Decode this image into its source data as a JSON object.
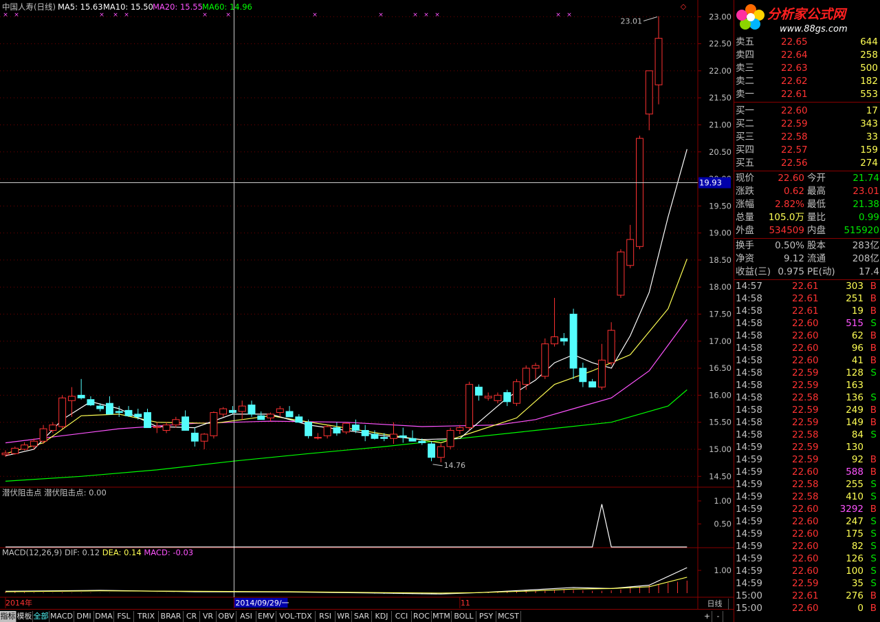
{
  "header": {
    "stock": "中国人寿(日线)",
    "ma5": "MA5: 15.63",
    "ma10": "MA10: 15.50",
    "ma20": "MA20: 15.55",
    "ma60": "MA60: 14.96"
  },
  "colors": {
    "up": "#ff3232",
    "down": "#54fcfc",
    "ma5": "#ffffff",
    "ma10": "#ffff54",
    "ma20": "#ff54ff",
    "ma60": "#00ff00",
    "axis": "#8a0000",
    "text": "#c0c0c0"
  },
  "chart_data": {
    "type": "candlestick",
    "price_ylim": [
      14.3,
      23.08
    ],
    "price_ticks": [
      "23.00",
      "22.50",
      "22.00",
      "21.50",
      "21.00",
      "20.50",
      "20.00",
      "19.50",
      "19.00",
      "18.50",
      "18.00",
      "17.50",
      "17.00",
      "16.50",
      "16.00",
      "15.50",
      "15.00",
      "14.50"
    ],
    "crosshair_price": "19.93",
    "max_label": "23.01",
    "min_label": "14.76",
    "candles": [
      [
        14.9,
        14.98,
        14.86,
        14.93
      ],
      [
        14.92,
        15.05,
        14.9,
        15.02
      ],
      [
        15.0,
        15.13,
        14.98,
        15.08
      ],
      [
        15.06,
        15.2,
        15.0,
        15.15
      ],
      [
        15.15,
        15.45,
        15.1,
        15.38
      ],
      [
        15.35,
        15.5,
        15.3,
        15.45
      ],
      [
        15.42,
        16.0,
        15.38,
        15.95
      ],
      [
        15.9,
        16.15,
        15.6,
        15.98
      ],
      [
        16.0,
        16.3,
        15.92,
        15.95
      ],
      [
        15.92,
        15.98,
        15.8,
        15.82
      ],
      [
        15.8,
        15.85,
        15.7,
        15.75
      ],
      [
        15.85,
        15.98,
        15.8,
        15.65
      ],
      [
        15.7,
        15.8,
        15.6,
        15.68
      ],
      [
        15.72,
        15.8,
        15.6,
        15.62
      ],
      [
        15.65,
        15.75,
        15.55,
        15.6
      ],
      [
        15.68,
        15.75,
        15.55,
        15.4
      ],
      [
        15.4,
        15.5,
        15.3,
        15.42
      ],
      [
        15.35,
        15.5,
        15.3,
        15.45
      ],
      [
        15.45,
        15.6,
        15.4,
        15.55
      ],
      [
        15.6,
        15.72,
        15.5,
        15.35
      ],
      [
        15.3,
        15.4,
        15.05,
        15.15
      ],
      [
        15.15,
        15.3,
        15.0,
        15.28
      ],
      [
        15.25,
        15.7,
        15.2,
        15.68
      ],
      [
        15.65,
        15.78,
        15.6,
        15.75
      ],
      [
        15.72,
        15.8,
        15.65,
        15.68
      ],
      [
        15.7,
        15.9,
        15.55,
        15.8
      ],
      [
        15.82,
        15.9,
        15.6,
        15.65
      ],
      [
        15.62,
        15.7,
        15.55,
        15.55
      ],
      [
        15.58,
        15.68,
        15.52,
        15.65
      ],
      [
        15.68,
        15.8,
        15.6,
        15.75
      ],
      [
        15.7,
        15.8,
        15.62,
        15.6
      ],
      [
        15.6,
        15.65,
        15.5,
        15.5
      ],
      [
        15.5,
        15.55,
        15.2,
        15.25
      ],
      [
        15.22,
        15.3,
        15.18,
        15.22
      ],
      [
        15.25,
        15.45,
        15.2,
        15.42
      ],
      [
        15.4,
        15.5,
        15.25,
        15.3
      ],
      [
        15.32,
        15.5,
        15.28,
        15.48
      ],
      [
        15.45,
        15.55,
        15.3,
        15.35
      ],
      [
        15.35,
        15.45,
        15.15,
        15.25
      ],
      [
        15.28,
        15.35,
        15.18,
        15.2
      ],
      [
        15.22,
        15.3,
        15.15,
        15.2
      ],
      [
        15.2,
        15.5,
        15.1,
        15.28
      ],
      [
        15.25,
        15.4,
        15.12,
        15.22
      ],
      [
        15.2,
        15.35,
        15.15,
        15.15
      ],
      [
        15.15,
        15.2,
        15.08,
        15.12
      ],
      [
        15.1,
        15.15,
        14.78,
        14.85
      ],
      [
        14.85,
        15.1,
        14.76,
        15.05
      ],
      [
        15.05,
        15.4,
        15.0,
        15.35
      ],
      [
        15.35,
        15.45,
        15.28,
        15.4
      ],
      [
        15.4,
        16.25,
        15.35,
        16.2
      ],
      [
        16.15,
        16.2,
        15.9,
        16.0
      ],
      [
        15.95,
        16.05,
        15.9,
        15.98
      ],
      [
        15.9,
        16.05,
        15.85,
        16.0
      ],
      [
        16.05,
        16.1,
        15.8,
        15.88
      ],
      [
        15.85,
        16.3,
        15.8,
        16.25
      ],
      [
        16.2,
        16.55,
        16.1,
        16.5
      ],
      [
        16.5,
        16.6,
        16.3,
        16.55
      ],
      [
        16.35,
        17.05,
        16.3,
        16.95
      ],
      [
        16.95,
        17.8,
        16.9,
        17.08
      ],
      [
        17.05,
        17.15,
        16.92,
        17.0
      ],
      [
        17.5,
        17.6,
        16.3,
        16.5
      ],
      [
        16.5,
        16.6,
        16.15,
        16.25
      ],
      [
        16.25,
        16.3,
        16.15,
        16.15
      ],
      [
        16.15,
        16.95,
        16.1,
        16.65
      ],
      [
        16.6,
        17.35,
        16.55,
        17.2
      ],
      [
        17.85,
        18.7,
        17.8,
        18.65
      ],
      [
        18.4,
        19.15,
        18.35,
        18.88
      ],
      [
        18.75,
        20.8,
        18.7,
        20.75
      ],
      [
        21.2,
        21.4,
        20.9,
        22.0
      ],
      [
        21.74,
        23.01,
        21.38,
        22.6
      ]
    ],
    "series_ma60": [
      [
        0,
        14.41
      ],
      [
        8,
        14.5
      ],
      [
        16,
        14.62
      ],
      [
        24,
        14.78
      ],
      [
        32,
        14.92
      ],
      [
        40,
        15.05
      ],
      [
        48,
        15.2
      ],
      [
        56,
        15.35
      ],
      [
        64,
        15.5
      ],
      [
        70,
        15.8
      ],
      [
        72,
        16.1
      ]
    ],
    "series_ma20": [
      [
        0,
        15.12
      ],
      [
        6,
        15.25
      ],
      [
        12,
        15.38
      ],
      [
        20,
        15.48
      ],
      [
        28,
        15.52
      ],
      [
        36,
        15.5
      ],
      [
        44,
        15.42
      ],
      [
        52,
        15.45
      ],
      [
        56,
        15.55
      ],
      [
        60,
        15.75
      ],
      [
        64,
        15.95
      ],
      [
        68,
        16.45
      ],
      [
        72,
        17.4
      ]
    ],
    "series_ma10": [
      [
        0,
        14.92
      ],
      [
        4,
        15.12
      ],
      [
        8,
        15.62
      ],
      [
        12,
        15.65
      ],
      [
        16,
        15.5
      ],
      [
        22,
        15.48
      ],
      [
        28,
        15.62
      ],
      [
        34,
        15.45
      ],
      [
        40,
        15.28
      ],
      [
        46,
        15.12
      ],
      [
        50,
        15.35
      ],
      [
        54,
        15.58
      ],
      [
        58,
        16.2
      ],
      [
        62,
        16.45
      ],
      [
        66,
        16.75
      ],
      [
        70,
        17.6
      ],
      [
        72,
        18.52
      ]
    ],
    "series_ma5": [
      [
        0,
        14.88
      ],
      [
        3,
        15.0
      ],
      [
        6,
        15.55
      ],
      [
        9,
        15.88
      ],
      [
        12,
        15.75
      ],
      [
        16,
        15.42
      ],
      [
        20,
        15.4
      ],
      [
        24,
        15.65
      ],
      [
        28,
        15.65
      ],
      [
        32,
        15.45
      ],
      [
        36,
        15.35
      ],
      [
        40,
        15.25
      ],
      [
        44,
        15.18
      ],
      [
        48,
        15.2
      ],
      [
        50,
        15.5
      ],
      [
        53,
        15.95
      ],
      [
        56,
        16.28
      ],
      [
        58,
        16.6
      ],
      [
        60,
        16.75
      ],
      [
        62,
        16.6
      ],
      [
        64,
        16.5
      ],
      [
        66,
        17.1
      ],
      [
        68,
        17.9
      ],
      [
        70,
        19.3
      ],
      [
        72,
        20.55
      ]
    ],
    "x_labels": [
      {
        "text": "2014年",
        "i": 0
      },
      {
        "text": "2014/09/29/一",
        "i": 24
      },
      {
        "text": "11",
        "i": 48
      }
    ],
    "panel2_title": "潜伏阻击点 潜伏阻击点: 0.00",
    "panel2_ticks": [
      "1.00",
      "0.50"
    ],
    "panel2_series": [
      [
        0,
        0
      ],
      [
        62,
        0
      ],
      [
        63,
        0.93
      ],
      [
        64,
        0
      ],
      [
        72,
        0
      ]
    ],
    "panel3_title": "MACD(12,26,9)",
    "panel3_dif": "DIF: 0.12",
    "panel3_dea": "DEA: 0.14",
    "panel3_macd": "MACD: -0.03",
    "panel3_ticks": [
      "1.00"
    ],
    "macd_dif": [
      [
        0,
        0.08
      ],
      [
        10,
        0.12
      ],
      [
        20,
        0.06
      ],
      [
        30,
        0.05
      ],
      [
        40,
        0.0
      ],
      [
        46,
        -0.04
      ],
      [
        50,
        0.02
      ],
      [
        56,
        0.15
      ],
      [
        60,
        0.25
      ],
      [
        64,
        0.2
      ],
      [
        68,
        0.35
      ],
      [
        72,
        1.12
      ]
    ],
    "macd_dea": [
      [
        0,
        0.06
      ],
      [
        10,
        0.1
      ],
      [
        20,
        0.08
      ],
      [
        30,
        0.06
      ],
      [
        40,
        0.02
      ],
      [
        46,
        0.0
      ],
      [
        50,
        0.02
      ],
      [
        56,
        0.1
      ],
      [
        60,
        0.18
      ],
      [
        64,
        0.2
      ],
      [
        68,
        0.28
      ],
      [
        72,
        0.7
      ]
    ],
    "macd_hist": [
      0.05,
      0.05,
      0.04,
      0.03,
      0.03,
      0.02,
      0.03,
      0.02,
      0.02,
      0.02,
      0.01,
      0.01,
      0.0,
      0.0,
      0.0,
      0.0,
      0.01,
      0.01,
      0.0,
      0.0,
      0.0,
      0.0,
      0.0,
      0.0,
      0.0,
      0.0,
      0.0,
      0.0,
      0.0,
      0.0,
      0.0,
      0.0,
      0.0,
      0.0,
      0.0,
      0.0,
      0.0,
      0.0,
      0.0,
      -0.02,
      -0.03,
      -0.03,
      -0.04,
      -0.04,
      -0.05,
      -0.05,
      -0.04,
      -0.03,
      0.0,
      0.02,
      0.04,
      0.05,
      0.06,
      0.08,
      0.1,
      0.11,
      0.12,
      0.13,
      0.15,
      0.16,
      0.14,
      0.12,
      0.1,
      0.1,
      0.12,
      0.16,
      0.22,
      0.28,
      0.34,
      0.4,
      0.45,
      0.5,
      0.55
    ]
  },
  "quote": {
    "sell_header": "卖",
    "sell": [
      {
        "label": "卖五",
        "price": "22.65",
        "vol": "644"
      },
      {
        "label": "卖四",
        "price": "22.64",
        "vol": "258"
      },
      {
        "label": "卖三",
        "price": "22.63",
        "vol": "500"
      },
      {
        "label": "卖二",
        "price": "22.62",
        "vol": "182"
      },
      {
        "label": "卖一",
        "price": "22.61",
        "vol": "553"
      }
    ],
    "buy": [
      {
        "label": "买一",
        "price": "22.60",
        "vol": "17"
      },
      {
        "label": "买二",
        "price": "22.59",
        "vol": "343"
      },
      {
        "label": "买三",
        "price": "22.58",
        "vol": "33"
      },
      {
        "label": "买四",
        "price": "22.57",
        "vol": "159"
      },
      {
        "label": "买五",
        "price": "22.56",
        "vol": "274"
      }
    ],
    "stats": [
      {
        "l1": "现价",
        "v1": "22.60",
        "c1": "#ff3232",
        "l2": "今开",
        "v2": "21.74",
        "c2": "#00e600"
      },
      {
        "l1": "涨跌",
        "v1": "0.62",
        "c1": "#ff3232",
        "l2": "最高",
        "v2": "23.01",
        "c2": "#ff3232"
      },
      {
        "l1": "涨幅",
        "v1": "2.82%",
        "c1": "#ff3232",
        "l2": "最低",
        "v2": "21.38",
        "c2": "#00e600"
      },
      {
        "l1": "总量",
        "v1": "105.0万",
        "c1": "#ffff54",
        "l2": "量比",
        "v2": "0.99",
        "c2": "#00e600"
      },
      {
        "l1": "外盘",
        "v1": "534509",
        "c1": "#ff3232",
        "l2": "内盘",
        "v2": "515920",
        "c2": "#00e600"
      }
    ],
    "stats2": [
      {
        "l1": "换手",
        "v1": "0.50%",
        "l2": "股本",
        "v2": "283亿"
      },
      {
        "l1": "净资",
        "v1": "9.12",
        "l2": "流通",
        "v2": "208亿"
      },
      {
        "l1": "收益(三)",
        "v1": "0.975",
        "l2": "PE(动)",
        "v2": "17.4"
      }
    ],
    "ticks": [
      [
        "14:57",
        "22.61",
        "303",
        "B"
      ],
      [
        "14:58",
        "22.61",
        "251",
        "B"
      ],
      [
        "14:58",
        "22.61",
        "19",
        "B"
      ],
      [
        "14:58",
        "22.60",
        "515",
        "S"
      ],
      [
        "14:58",
        "22.60",
        "62",
        "B"
      ],
      [
        "14:58",
        "22.60",
        "96",
        "B"
      ],
      [
        "14:58",
        "22.60",
        "41",
        "B"
      ],
      [
        "14:58",
        "22.59",
        "128",
        "S"
      ],
      [
        "14:58",
        "22.59",
        "163",
        ""
      ],
      [
        "14:58",
        "22.58",
        "136",
        "S"
      ],
      [
        "14:58",
        "22.59",
        "249",
        "B"
      ],
      [
        "14:58",
        "22.59",
        "149",
        "B"
      ],
      [
        "14:58",
        "22.58",
        "84",
        "S"
      ],
      [
        "14:59",
        "22.59",
        "130",
        ""
      ],
      [
        "14:59",
        "22.59",
        "92",
        "B"
      ],
      [
        "14:59",
        "22.60",
        "588",
        "B"
      ],
      [
        "14:59",
        "22.58",
        "255",
        "S"
      ],
      [
        "14:59",
        "22.58",
        "410",
        "S"
      ],
      [
        "14:59",
        "22.60",
        "3292",
        "B"
      ],
      [
        "14:59",
        "22.60",
        "247",
        "S"
      ],
      [
        "14:59",
        "22.60",
        "175",
        "S"
      ],
      [
        "14:59",
        "22.60",
        "82",
        "S"
      ],
      [
        "14:59",
        "22.60",
        "126",
        "S"
      ],
      [
        "14:59",
        "22.60",
        "100",
        "S"
      ],
      [
        "14:59",
        "22.59",
        "35",
        "S"
      ],
      [
        "15:00",
        "22.61",
        "276",
        "B"
      ],
      [
        "15:00",
        "22.60",
        "0",
        "B"
      ]
    ],
    "logo_text": "分析家公式网",
    "logo_url": "www.88gs.com"
  },
  "bottom_tabs": [
    "指标",
    "模板",
    "全部",
    "MACD",
    "DMI",
    "DMA",
    "FSL",
    "TRIX",
    "BRAR",
    "CR",
    "VR",
    "OBV",
    "ASI",
    "EMV",
    "VOL-TDX",
    "RSI",
    "WR",
    "SAR",
    "KDJ",
    "CCI",
    "ROC",
    "MTM",
    "BOLL",
    "PSY",
    "MCST"
  ],
  "period_label": "日线",
  "zoom_plus": "+",
  "zoom_minus": "-"
}
